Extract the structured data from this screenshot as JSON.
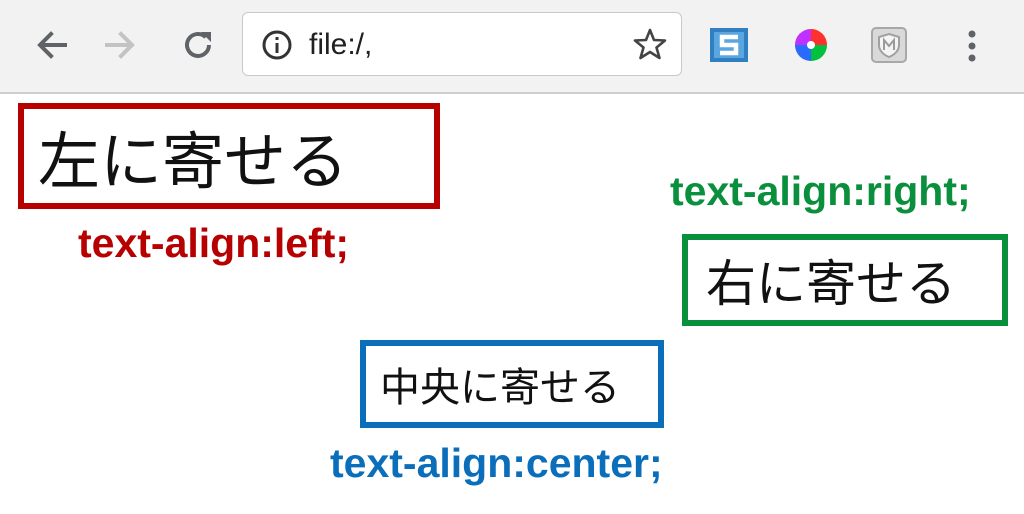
{
  "browser": {
    "url": "file:/,",
    "icons": {
      "back": "arrow-left-icon",
      "forward": "arrow-right-icon",
      "reload": "reload-icon",
      "info": "info-icon",
      "bookmark": "star-icon",
      "ext1": "s-extension-icon",
      "ext2": "color-wheel-icon",
      "ext3": "shield-extension-icon",
      "menu": "kebab-menu-icon"
    }
  },
  "demos": {
    "left": {
      "text": "左に寄せる",
      "caption": "text-align:left;",
      "color": "#b70000"
    },
    "right": {
      "text": "右に寄せる",
      "caption": "text-align:right;",
      "color": "#0a8f3c"
    },
    "center": {
      "text": "中央に寄せる",
      "caption": "text-align:center;",
      "color": "#0b6ebb"
    }
  }
}
